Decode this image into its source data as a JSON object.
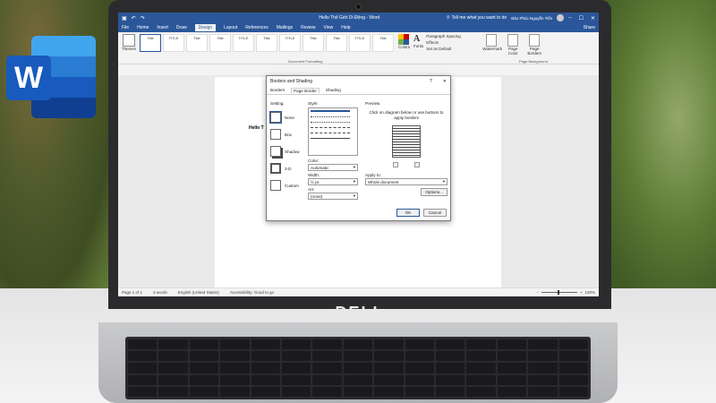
{
  "word_logo": {
    "letter": "W"
  },
  "brand": "DELL",
  "window": {
    "title": "Hello Thế Giới Di Động  -  Word",
    "search_placeholder": "Tell me what you want to do",
    "user": "Bảo Phúc Nguyễn Tiến",
    "controls": [
      "–",
      "☐",
      "✕"
    ]
  },
  "ribbon": {
    "tabs": [
      "File",
      "Home",
      "Insert",
      "Draw",
      "Design",
      "Layout",
      "References",
      "Mailings",
      "Review",
      "View",
      "Help"
    ],
    "active_tab": "Design",
    "share": "Share",
    "themes": "Themes",
    "styles": [
      "Title",
      "TITLE",
      "Title",
      "Title",
      "TITLE",
      "Title",
      "TITLE",
      "Title",
      "Title",
      "TITLE",
      "Title"
    ],
    "colors": "Colors",
    "fonts": "Fonts",
    "paragraph_spacing": "Paragraph Spacing",
    "effects": "Effects",
    "set_default": "Set as Default",
    "group_document_formatting": "Document Formatting",
    "watermark": "Watermark",
    "page_color": "Page Color",
    "page_borders": "Page Borders",
    "group_page_background": "Page Background"
  },
  "document": {
    "text": "Hello T"
  },
  "status": {
    "page": "Page 1 of 1",
    "words": "3 words",
    "language": "English (United States)",
    "accessibility": "Accessibility: Good to go",
    "zoom": "100%"
  },
  "dialog": {
    "title": "Borders and Shading",
    "help": "?",
    "close": "✕",
    "tabs": [
      "Borders",
      "Page Border",
      "Shading"
    ],
    "active_tab": "Page Border",
    "setting_label": "Setting:",
    "settings": [
      "None",
      "Box",
      "Shadow",
      "3-D",
      "Custom"
    ],
    "style_label": "Style:",
    "color_label": "Color:",
    "color_value": "Automatic",
    "width_label": "Width:",
    "width_value": "½ pt",
    "art_label": "Art:",
    "art_value": "(none)",
    "preview_label": "Preview",
    "preview_note": "Click on diagram below or use buttons to apply borders",
    "apply_label": "Apply to:",
    "apply_value": "Whole document",
    "options": "Options...",
    "ok": "OK",
    "cancel": "Cancel"
  }
}
